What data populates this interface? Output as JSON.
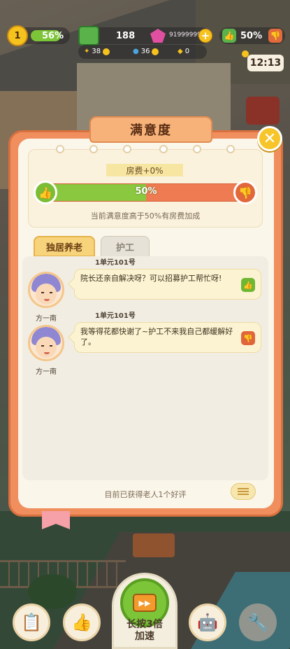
{
  "hud": {
    "level": "1",
    "xp_percent_label": "56%",
    "xp_fraction": 0.56,
    "cash": "188",
    "gems": "91999999",
    "wood": "38",
    "water": "36",
    "special": "0",
    "rating_label": "50%",
    "clock": "12:13"
  },
  "modal": {
    "title": "满意度",
    "rent_bonus": "房费+0%",
    "satisfaction_label": "50%",
    "satisfaction_fraction": 0.5,
    "bonus_note": "当前满意度高于50%有房费加成",
    "tabs": [
      {
        "label": "独居养老",
        "active": true
      },
      {
        "label": "护工",
        "active": false
      }
    ],
    "messages": [
      {
        "room": "1单元101号",
        "name": "方一南",
        "text": "院长还亲自解决呀？可以招募护工帮忙呀!",
        "sentiment": "like"
      },
      {
        "room": "1单元101号",
        "name": "方一南",
        "text": "我等得花都快谢了~护工不来我自己都缓解好了。",
        "sentiment": "dislike"
      }
    ],
    "footer_note": "目前已获得老人1个好评"
  },
  "bottom_bar": {
    "speed_label_line1": "长按3倍",
    "speed_label_line2": "加速",
    "buttons": [
      "clipboard-icon",
      "thumbs-up-icon",
      "robot-icon",
      "wrench-icon"
    ]
  },
  "colors": {
    "like_green": "#7cbd35",
    "dislike_orange": "#e2673b",
    "modal_orange": "#f08f5d",
    "cream": "#fbf6ea"
  }
}
